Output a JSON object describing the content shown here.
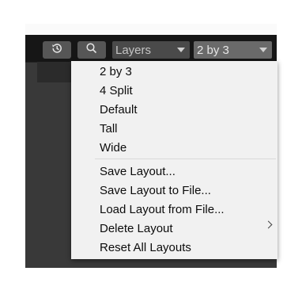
{
  "toolbar": {
    "history_icon": "history-icon",
    "search_icon": "search-icon",
    "layers_dropdown": {
      "label": "Layers"
    },
    "layout_dropdown": {
      "label": "2 by 3"
    }
  },
  "layout_menu": {
    "items": [
      {
        "label": "2 by 3"
      },
      {
        "label": "4 Split"
      },
      {
        "label": "Default"
      },
      {
        "label": "Tall"
      },
      {
        "label": "Wide"
      },
      {
        "label": "Save Layout..."
      },
      {
        "label": "Save Layout to File..."
      },
      {
        "label": "Load Layout from File..."
      },
      {
        "label": "Delete Layout",
        "has_submenu": true
      },
      {
        "label": "Reset All Layouts"
      }
    ]
  },
  "colors": {
    "toolbar_bg": "#161616",
    "panel_bg": "#393939",
    "menu_bg": "#f1f1f1",
    "dropdown_active_bg": "#6a6a6a"
  }
}
